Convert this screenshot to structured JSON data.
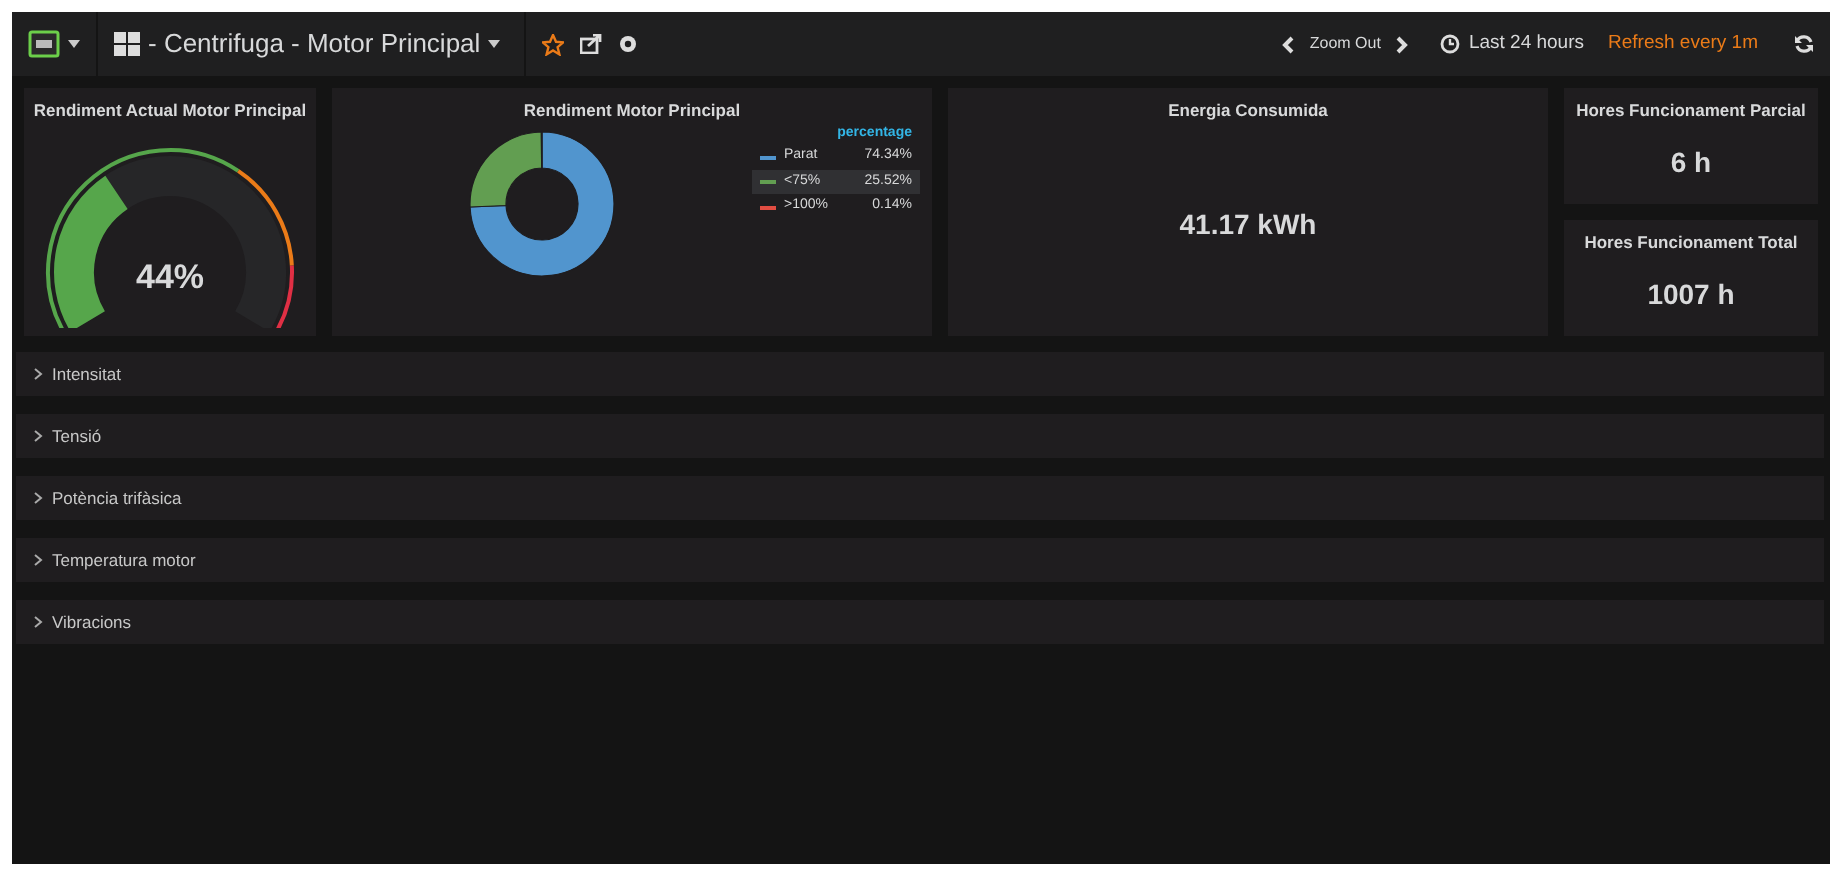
{
  "topbar": {
    "title": "- Centrifuga - Motor Principal",
    "zoom_out": "Zoom Out",
    "time_range": "Last 24 hours",
    "refresh": "Refresh every 1m"
  },
  "panels": {
    "gauge": {
      "title": "Rendiment Actual Motor Principal",
      "value": "44%"
    },
    "pie": {
      "title": "Rendiment Motor Principal",
      "legend": [
        {
          "value": "74.34%",
          "color": "#5195ce",
          "selected": false
        },
        {
          "value": "25.52%",
          "color": "#629e51",
          "selected": true
        },
        {
          "value": "0.14%",
          "color": "#e24d42",
          "selected": false
        }
      ],
      "chart_data": {
        "type": "donut",
        "categories": [
          "Parat",
          "<75%",
          ">100%"
        ],
        "series": [
          {
            "name": "percentage",
            "values": [
              74.34,
              25.52,
              0.14
            ]
          }
        ]
      }
    },
    "energy": {
      "title": "Energia Consumida",
      "value": "41.17 kWh"
    },
    "stats": [
      {
        "title": "Hores Funcionament Parcial",
        "value": "6 h"
      },
      {
        "title": "Hores Funcionament Total",
        "value": "1007 h"
      }
    ]
  },
  "rows": [
    {
      "title": "Intensitat",
      "expanded": false
    },
    {
      "title": "Tensió",
      "expanded": false
    },
    {
      "title": "Potència trifàsica",
      "expanded": false
    },
    {
      "title": "Temperatura motor",
      "expanded": false
    },
    {
      "title": "Vibracions",
      "expanded": false
    }
  ]
}
